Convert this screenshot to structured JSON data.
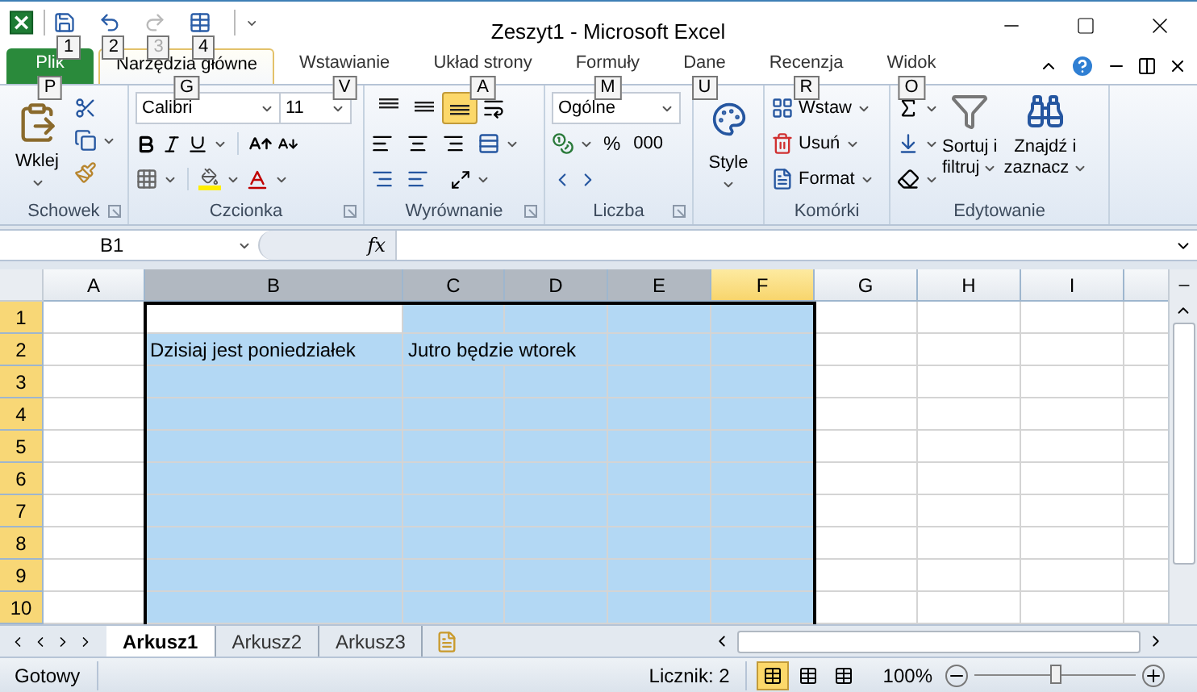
{
  "window": {
    "title": "Zeszyt1 - Microsoft Excel"
  },
  "quick_access": [
    {
      "keytip": "1",
      "disabled": false
    },
    {
      "keytip": "2",
      "disabled": false
    },
    {
      "keytip": "3",
      "disabled": true
    },
    {
      "keytip": "4",
      "disabled": false
    }
  ],
  "tabs": [
    {
      "label": "Plik",
      "kind": "file",
      "selected": false,
      "keytip": "P"
    },
    {
      "label": "Narzędzia główne",
      "kind": "tab",
      "selected": true,
      "keytip": "G"
    },
    {
      "label": "Wstawianie",
      "kind": "tab",
      "selected": false,
      "keytip": "V"
    },
    {
      "label": "Układ strony",
      "kind": "tab",
      "selected": false,
      "keytip": "A"
    },
    {
      "label": "Formuły",
      "kind": "tab",
      "selected": false,
      "keytip": "M"
    },
    {
      "label": "Dane",
      "kind": "tab",
      "selected": false,
      "keytip": "U"
    },
    {
      "label": "Recenzja",
      "kind": "tab",
      "selected": false,
      "keytip": "R"
    },
    {
      "label": "Widok",
      "kind": "tab",
      "selected": false,
      "keytip": "O"
    }
  ],
  "ribbon": {
    "clipboard": {
      "label": "Schowek",
      "paste": "Wklej"
    },
    "font": {
      "label": "Czcionka",
      "name": "Calibri",
      "size": "11"
    },
    "alignment": {
      "label": "Wyrównanie",
      "vertical": [
        {
          "selected": false
        },
        {
          "selected": false
        },
        {
          "selected": true
        }
      ]
    },
    "number": {
      "label": "Liczba",
      "format": "Ogólne",
      "percent": "%",
      "thousands": "000"
    },
    "styles": {
      "button": "Style"
    },
    "cells": {
      "label": "Komórki",
      "buttons": [
        "Wstaw",
        "Usuń",
        "Format"
      ]
    },
    "editing": {
      "label": "Edytowanie",
      "sort": [
        "Sortuj i",
        "filtruj"
      ],
      "find": [
        "Znajdź i",
        "zaznacz"
      ]
    }
  },
  "formula_bar": {
    "name_box": "B1",
    "function_label": "fx"
  },
  "columns": [
    {
      "label": "A",
      "selected": false,
      "hot": false
    },
    {
      "label": "B",
      "selected": true,
      "hot": false
    },
    {
      "label": "C",
      "selected": true,
      "hot": false
    },
    {
      "label": "D",
      "selected": true,
      "hot": false
    },
    {
      "label": "E",
      "selected": true,
      "hot": false
    },
    {
      "label": "F",
      "selected": true,
      "hot": true
    },
    {
      "label": "G",
      "selected": false,
      "hot": false
    },
    {
      "label": "H",
      "selected": false,
      "hot": false
    },
    {
      "label": "I",
      "selected": false,
      "hot": false
    }
  ],
  "rows": [
    {
      "label": "1",
      "selected": true,
      "cells": [
        {},
        {
          "active": true
        }
      ]
    },
    {
      "label": "2",
      "selected": true,
      "cells": [
        {},
        {
          "text": "Dzisiaj jest poniedziałek"
        },
        {
          "text": "Jutro będzie wtorek"
        }
      ]
    },
    {
      "label": "3",
      "selected": true
    },
    {
      "label": "4",
      "selected": true
    },
    {
      "label": "5",
      "selected": true
    },
    {
      "label": "6",
      "selected": true
    },
    {
      "label": "7",
      "selected": true
    },
    {
      "label": "8",
      "selected": true
    },
    {
      "label": "9",
      "selected": true
    },
    {
      "label": "10",
      "selected": true
    }
  ],
  "sheets": [
    {
      "label": "Arkusz1",
      "selected": true
    },
    {
      "label": "Arkusz2",
      "selected": false
    },
    {
      "label": "Arkusz3",
      "selected": false
    }
  ],
  "status_bar": {
    "mode": "Gotowy",
    "count": "Licznik: 2",
    "views": [
      {
        "selected": true
      },
      {
        "selected": false
      },
      {
        "selected": false
      }
    ],
    "zoom": "100%",
    "zoom_slider": {
      "level": 0.5
    }
  }
}
